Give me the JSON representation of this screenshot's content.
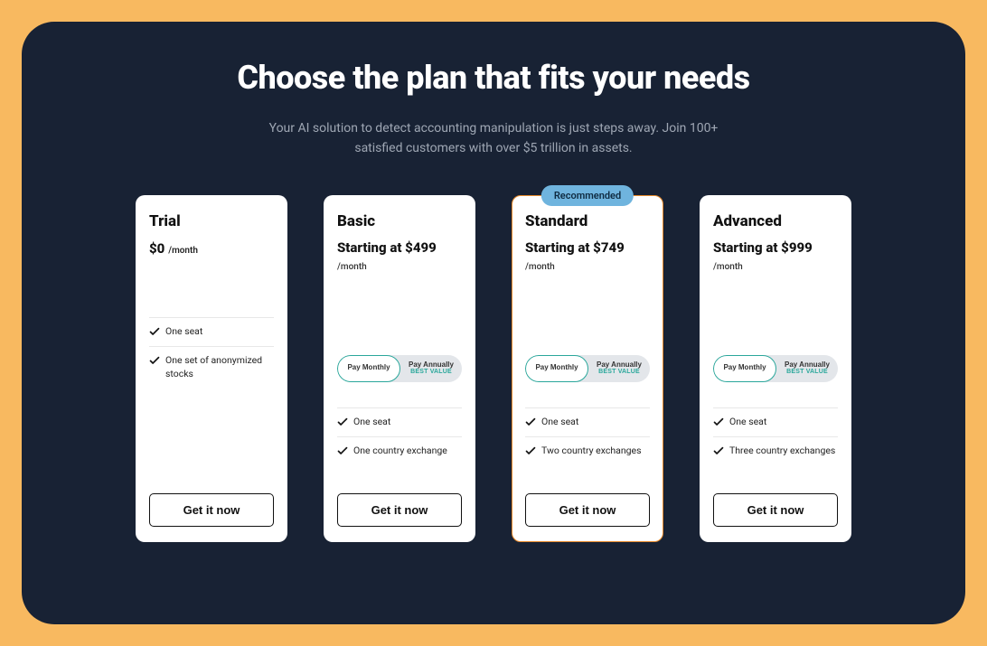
{
  "heading": "Choose the plan that fits your needs",
  "subheading": "Your AI solution to detect accounting manipulation is just steps away. Join 100+ satisfied customers with over $5 trillion in assets.",
  "recommended_label": "Recommended",
  "toggle": {
    "monthly": "Pay Monthly",
    "annually": "Pay Annually",
    "best_value": "BEST VALUE"
  },
  "cta": "Get it now",
  "plans": {
    "trial": {
      "name": "Trial",
      "price": "$0",
      "suffix": "/month",
      "features": [
        "One seat",
        "One set of anonymized stocks"
      ]
    },
    "basic": {
      "name": "Basic",
      "price": "Starting at $499",
      "per": "/month",
      "features": [
        "One seat",
        "One country exchange"
      ]
    },
    "standard": {
      "name": "Standard",
      "price": "Starting at $749",
      "per": "/month",
      "features": [
        "One seat",
        "Two country exchanges"
      ]
    },
    "advanced": {
      "name": "Advanced",
      "price": "Starting at $999",
      "per": "/month",
      "features": [
        "One seat",
        "Three country exchanges"
      ]
    }
  }
}
